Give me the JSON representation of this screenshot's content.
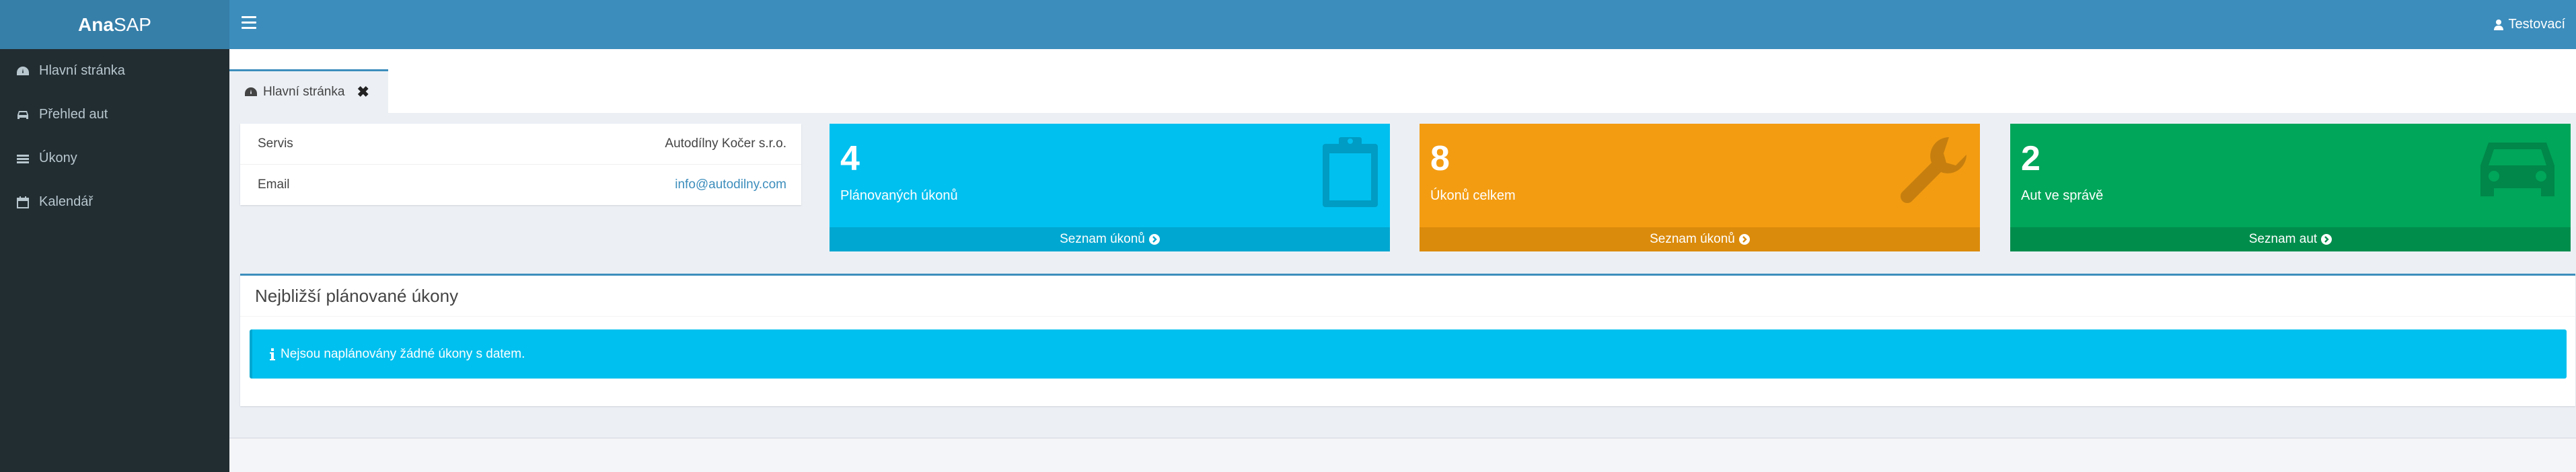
{
  "app": {
    "logo_bold": "Ana",
    "logo_light": "SAP"
  },
  "sidebar": {
    "items": [
      {
        "label": "Hlavní stránka",
        "icon": "dashboard-icon"
      },
      {
        "label": "Přehled aut",
        "icon": "car-icon"
      },
      {
        "label": "Úkony",
        "icon": "list-icon"
      },
      {
        "label": "Kalendář",
        "icon": "calendar-icon"
      }
    ]
  },
  "header": {
    "user_name": "Testovací"
  },
  "tabs": [
    {
      "label": "Hlavní stránka",
      "icon": "dashboard-icon",
      "close": "✖"
    }
  ],
  "info": {
    "rows": [
      {
        "label": "Servis",
        "value": "Autodílny Kočer s.r.o."
      },
      {
        "label": "Email",
        "value": "info@autodilny.com"
      }
    ]
  },
  "boxes": [
    {
      "number": "4",
      "text": "Plánovaných úkonů",
      "footer": "Seznam úkonů",
      "color": "#00c0ef",
      "icon": "clipboard-icon"
    },
    {
      "number": "8",
      "text": "Úkonů celkem",
      "footer": "Seznam úkonů",
      "color": "#f39c12",
      "icon": "wrench-icon"
    },
    {
      "number": "2",
      "text": "Aut ve správě",
      "footer": "Seznam aut",
      "color": "#00a65a",
      "icon": "car-icon"
    }
  ],
  "panel": {
    "title": "Nejbližší plánované úkony",
    "alert": "Nejsou naplánovány žádné úkony s datem."
  },
  "colors": {
    "header": "#3c8dbc",
    "sidebar": "#222d32",
    "logo_bg": "#367fa9",
    "aqua": "#00c0ef",
    "yellow": "#f39c12",
    "green": "#00a65a"
  }
}
